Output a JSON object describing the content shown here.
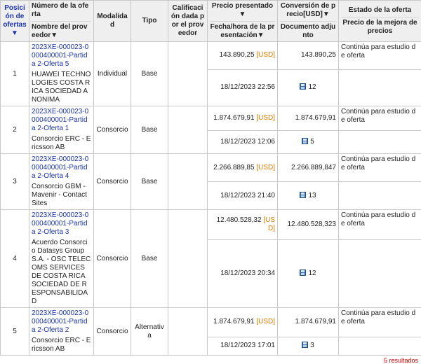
{
  "headers": {
    "position": "Posición de oferta",
    "sort_arrow": "s▼",
    "offer_number": "Número de la oferta",
    "supplier_name": "Nombre del proveedor▼",
    "modality": "Modalidad",
    "type": "Tipo",
    "rating": "Calificación dada por el proveedor",
    "price_presented": "Precio presentado▼",
    "datetime_presented": "Fecha/hora de la presentación▼",
    "price_conversion": "Conversión de precio[USD]▼",
    "attached_document": "Documento adjunto",
    "offer_status": "Estado de la oferta",
    "best_price": "Precio de la mejora de precios"
  },
  "rows": [
    {
      "position": "1",
      "offer_id": "2023XE-000023-0000400001-Partida 2-Oferta 5",
      "supplier": "HUAWEI TECHNOLOGIES COSTA RICA SOCIEDAD ANONIMA",
      "modality": "Individual",
      "type": "Base",
      "rating": "",
      "price": "143.890,25",
      "currency": "[USD]",
      "conversion": "143.890,25",
      "datetime": "18/12/2023 22:56",
      "docs": "12",
      "status": "Continúa para estudio de oferta",
      "best_price": ""
    },
    {
      "position": "2",
      "offer_id": "2023XE-000023-0000400001-Partida 2-Oferta 1",
      "supplier": "Consorcio ERC - Ericsson AB",
      "modality": "Consorcio",
      "type": "Base",
      "rating": "",
      "price": "1.874.679,91",
      "currency": "[USD]",
      "conversion": "1.874.679,91",
      "datetime": "18/12/2023 12:06",
      "docs": "5",
      "status": "Continúa para estudio de oferta",
      "best_price": ""
    },
    {
      "position": "3",
      "offer_id": "2023XE-000023-0000400001-Partida 2-Oferta 4",
      "supplier": "Consorcio GBM - Mavenir - Contact Sites",
      "modality": "Consorcio",
      "type": "Base",
      "rating": "",
      "price": "2.266.889,85",
      "currency": "[USD]",
      "conversion": "2.266.889,847",
      "datetime": "18/12/2023 21:40",
      "docs": "13",
      "status": "Continúa para estudio de oferta",
      "best_price": ""
    },
    {
      "position": "4",
      "offer_id": "2023XE-000023-0000400001-Partida 2-Oferta 3",
      "supplier": "Acuerdo Consorcio Datasys Group S.A. - OSC TELECOMS SERVICES DE COSTA RICA SOCIEDAD DE RESPONSABILIDAD",
      "modality": "Consorcio",
      "type": "Base",
      "rating": "",
      "price": "12.480.528,32",
      "currency": "[USD]",
      "conversion": "12.480.528,323",
      "datetime": "18/12/2023 20:34",
      "docs": "12",
      "status": "Continúa para estudio de oferta",
      "best_price": ""
    },
    {
      "position": "5",
      "offer_id": "2023XE-000023-0000400001-Partida 2-Oferta 2",
      "supplier": "Consorcio ERC - Ericsson AB",
      "modality": "Consorcio",
      "type": "Alternativa",
      "rating": "",
      "price": "1.874.679,91",
      "currency": "[USD]",
      "conversion": "1.874.679,91",
      "datetime": "18/12/2023 17:01",
      "docs": "3",
      "status": "Continúa para estudio de oferta",
      "best_price": ""
    }
  ],
  "footer": "5 resultados"
}
